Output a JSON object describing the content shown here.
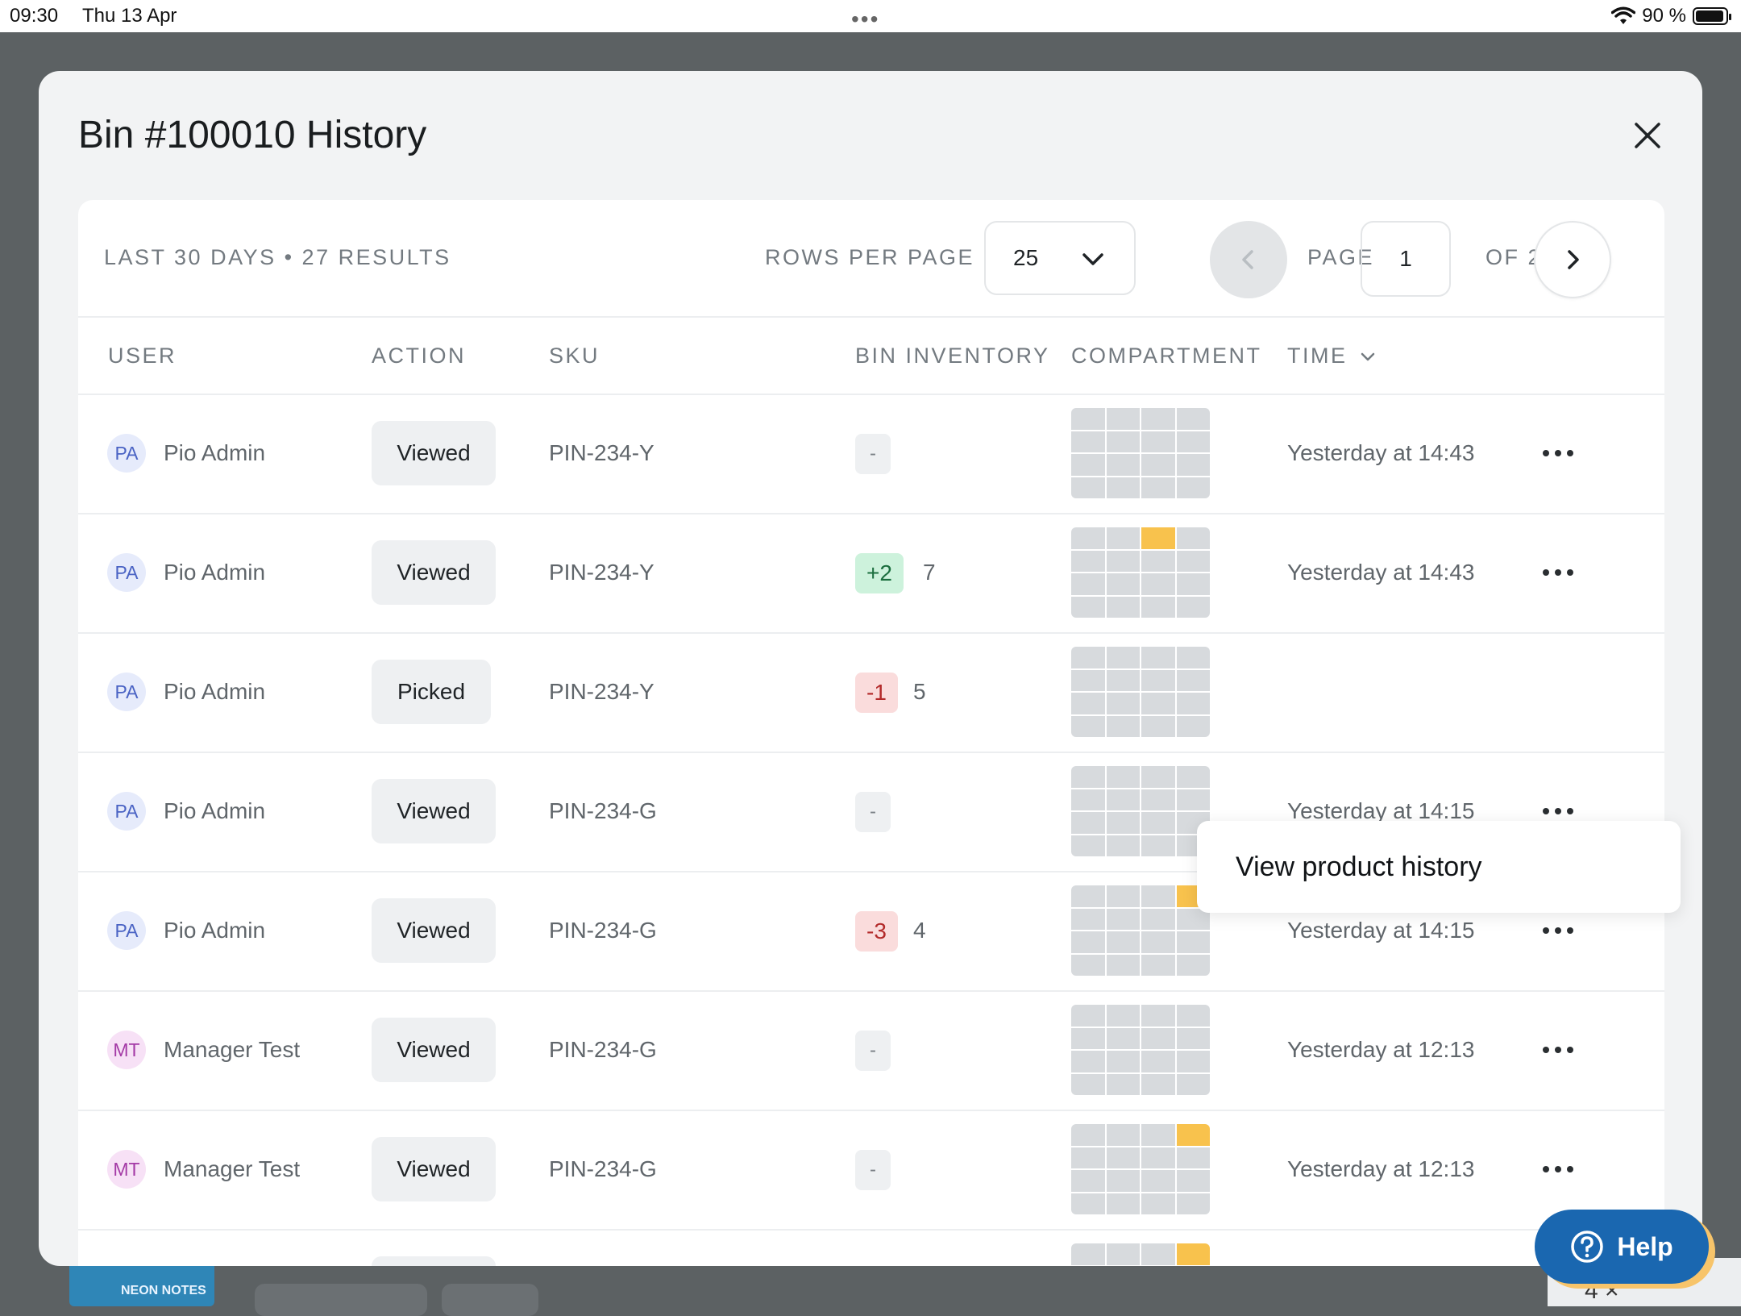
{
  "status_bar": {
    "time": "09:30",
    "date": "Thu 13 Apr",
    "battery": "90 %"
  },
  "background": {
    "product_label": "NEON NOTES",
    "right_text": "4 ×"
  },
  "modal": {
    "title": "Bin #100010 History",
    "summary": "LAST 30 DAYS • 27 RESULTS",
    "rows_per_page_label": "ROWS PER PAGE",
    "rows_per_page_value": "25",
    "page_label": "PAGE",
    "page_value": "1",
    "of_label": "OF 2"
  },
  "columns": {
    "user": "USER",
    "action": "ACTION",
    "sku": "SKU",
    "bin_inventory": "BIN INVENTORY",
    "compartment": "COMPARTMENT",
    "time": "TIME"
  },
  "rows": [
    {
      "initials": "PA",
      "user": "Pio Admin",
      "action": "Viewed",
      "sku": "PIN-234-Y",
      "delta": "-",
      "delta_type": "neutral",
      "count": "",
      "time": "Yesterday at 14:43",
      "compartment": []
    },
    {
      "initials": "PA",
      "user": "Pio Admin",
      "action": "Viewed",
      "sku": "PIN-234-Y",
      "delta": "+2",
      "delta_type": "pos",
      "count": "7",
      "time": "Yesterday at 14:43",
      "compartment": [
        2
      ]
    },
    {
      "initials": "PA",
      "user": "Pio Admin",
      "action": "Picked",
      "sku": "PIN-234-Y",
      "delta": "-1",
      "delta_type": "neg",
      "count": "5",
      "time": "",
      "compartment": []
    },
    {
      "initials": "PA",
      "user": "Pio Admin",
      "action": "Viewed",
      "sku": "PIN-234-G",
      "delta": "-",
      "delta_type": "neutral",
      "count": "",
      "time": "Yesterday at 14:15",
      "compartment": []
    },
    {
      "initials": "PA",
      "user": "Pio Admin",
      "action": "Viewed",
      "sku": "PIN-234-G",
      "delta": "-3",
      "delta_type": "neg",
      "count": "4",
      "time": "Yesterday at 14:15",
      "compartment": [
        3
      ]
    },
    {
      "initials": "MT",
      "user": "Manager Test",
      "action": "Viewed",
      "sku": "PIN-234-G",
      "delta": "-",
      "delta_type": "neutral",
      "count": "",
      "time": "Yesterday at 12:13",
      "compartment": []
    },
    {
      "initials": "MT",
      "user": "Manager Test",
      "action": "Viewed",
      "sku": "PIN-234-G",
      "delta": "-",
      "delta_type": "neutral",
      "count": "",
      "time": "Yesterday at 12:13",
      "compartment": [
        3
      ]
    }
  ],
  "context_menu": {
    "item": "View product history"
  },
  "help_button": {
    "label": "Help"
  },
  "colors": {
    "compartment_active": "#f8c24d",
    "compartment_empty": "#d7dadd",
    "help_blue": "#1a67b0"
  }
}
